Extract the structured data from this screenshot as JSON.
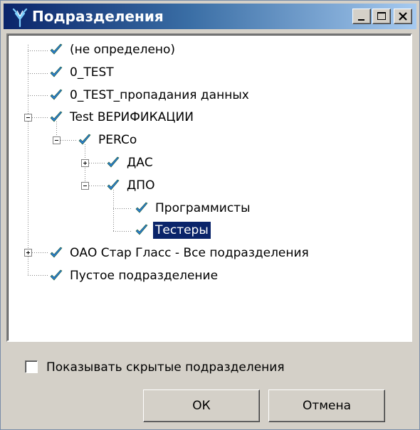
{
  "window": {
    "title": "Подразделения",
    "icon": "departments-icon",
    "controls": [
      "minimize-icon",
      "maximize-icon",
      "close-icon"
    ]
  },
  "tree": {
    "check_icon": "checkmark-icon",
    "check_color": "#2a7bd4",
    "items": [
      {
        "label": "(не определено)",
        "level": 0,
        "expander": "none"
      },
      {
        "label": "0_TEST",
        "level": 0,
        "expander": "none"
      },
      {
        "label": "0_TEST_пропадания данных",
        "level": 0,
        "expander": "none"
      },
      {
        "label": "Test ВЕРИФИКАЦИИ",
        "level": 0,
        "expander": "minus"
      },
      {
        "label": "PERCo",
        "level": 1,
        "expander": "minus"
      },
      {
        "label": "ДАС",
        "level": 2,
        "expander": "plus"
      },
      {
        "label": "ДПО",
        "level": 2,
        "expander": "minus"
      },
      {
        "label": "Программисты",
        "level": 3,
        "expander": "none"
      },
      {
        "label": "Тестеры",
        "level": 3,
        "expander": "none",
        "selected": true
      },
      {
        "label": "ОАО Стар Гласс - Все подразделения",
        "level": 0,
        "expander": "plus"
      },
      {
        "label": "Пустое подразделение",
        "level": 0,
        "expander": "none"
      }
    ]
  },
  "options": {
    "show_hidden_label": "Показывать скрытые подразделения",
    "show_hidden_checked": false
  },
  "buttons": {
    "ok_label": "ОК",
    "cancel_label": "Отмена"
  },
  "colors": {
    "title_gradient_start": "#0a246a",
    "title_gradient_end": "#a6caf0",
    "selection": "#0a246a",
    "dialog_bg": "#d4d0c8"
  }
}
